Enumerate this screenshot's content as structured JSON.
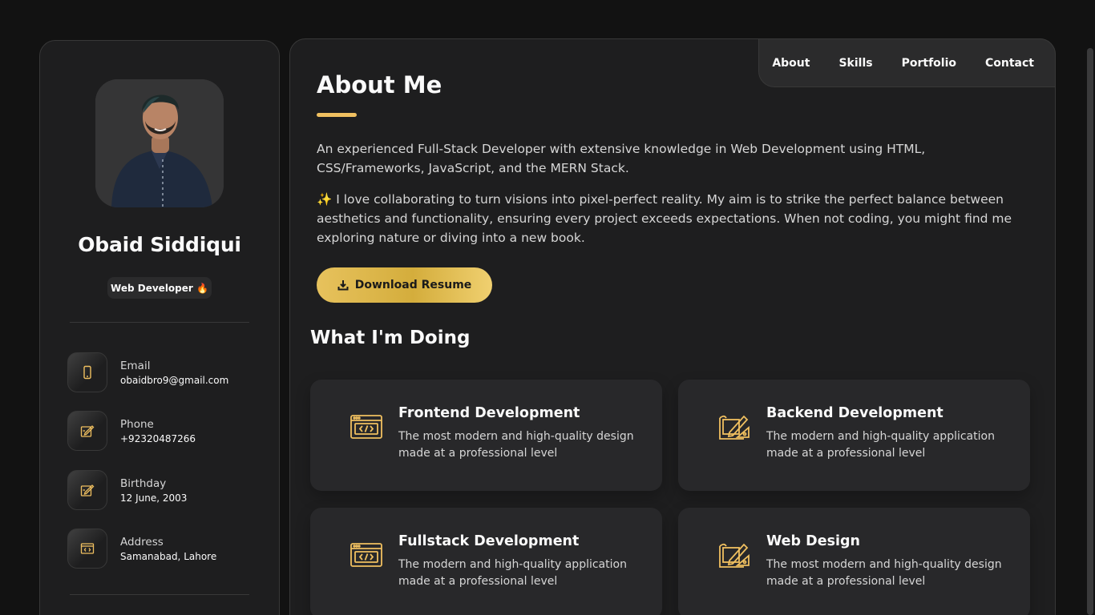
{
  "colors": {
    "accent": "#f0c060",
    "card": "#28282a",
    "panel": "#1e1e1f",
    "background": "#121212"
  },
  "sidebar": {
    "name": "Obaid Siddiqui",
    "title": "Web Developer 🔥",
    "contacts": [
      {
        "label": "Email",
        "value": "obaidbro9@gmail.com",
        "icon": "mobile-icon"
      },
      {
        "label": "Phone",
        "value": "+92320487266",
        "icon": "edit-icon"
      },
      {
        "label": "Birthday",
        "value": "12 June, 2003",
        "icon": "edit-icon"
      },
      {
        "label": "Address",
        "value": "Samanabad, Lahore",
        "icon": "code-window-icon"
      }
    ]
  },
  "navbar": {
    "links": [
      "About",
      "Skills",
      "Portfolio",
      "Contact"
    ]
  },
  "about": {
    "title": "About Me",
    "paragraphs": [
      "An experienced Full-Stack Developer with extensive knowledge in Web Development using HTML, CSS/Frameworks, JavaScript, and the MERN Stack.",
      "✨ I love collaborating to turn visions into pixel-perfect reality. My aim is to strike the perfect balance between aesthetics and functionality, ensuring every project exceeds expectations. When not coding, you might find me exploring nature or diving into a new book."
    ],
    "resume_button": "Download Resume",
    "services_title": "What I'm Doing",
    "services": [
      {
        "title": "Frontend Development",
        "desc": "The most modern and high-quality design made at a professional level",
        "icon": "code-window-icon"
      },
      {
        "title": "Backend Development",
        "desc": "The modern and high-quality application made at a professional level",
        "icon": "design-tools-icon"
      },
      {
        "title": "Fullstack Development",
        "desc": "The modern and high-quality application made at a professional level",
        "icon": "code-window-icon"
      },
      {
        "title": "Web Design",
        "desc": "The most modern and high-quality design made at a professional level",
        "icon": "design-tools-icon"
      }
    ]
  }
}
